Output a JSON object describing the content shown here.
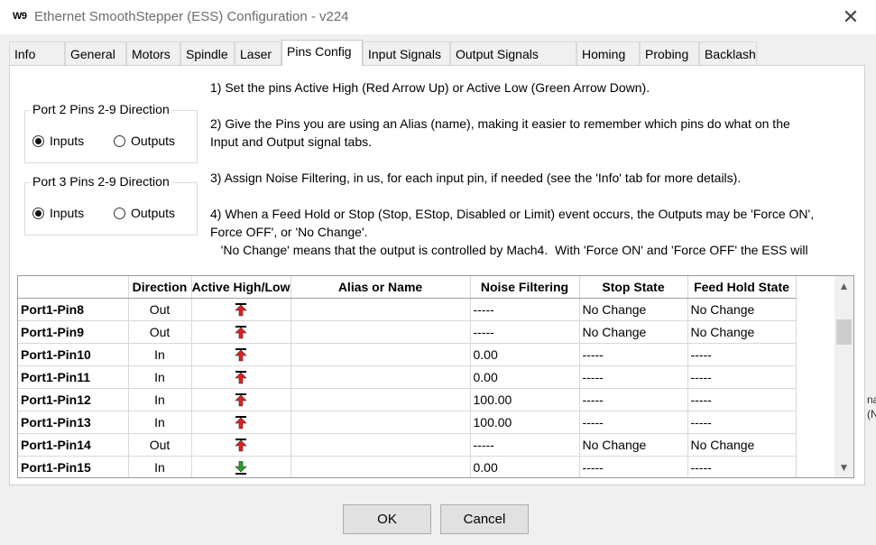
{
  "window": {
    "app_icon_text": "W9",
    "title": "Ethernet SmoothStepper (ESS) Configuration - v224",
    "close_icon": "close-icon"
  },
  "tabs": [
    {
      "label": "Info",
      "active": false
    },
    {
      "label": "General",
      "active": false
    },
    {
      "label": "Motors",
      "active": false
    },
    {
      "label": "Spindle",
      "active": false
    },
    {
      "label": "Laser",
      "active": false
    },
    {
      "label": "Pins Config",
      "active": true
    },
    {
      "label": "Input Signals",
      "active": false
    },
    {
      "label": "Output Signals",
      "active": false
    },
    {
      "label": "Homing",
      "active": false
    },
    {
      "label": "Probing",
      "active": false
    },
    {
      "label": "Backlash",
      "active": false
    }
  ],
  "port2": {
    "title": "Port 2 Pins 2-9 Direction",
    "option_inputs": "Inputs",
    "option_outputs": "Outputs",
    "selected": "Inputs"
  },
  "port3": {
    "title": "Port 3 Pins 2-9 Direction",
    "option_inputs": "Inputs",
    "option_outputs": "Outputs",
    "selected": "Inputs"
  },
  "instructions": {
    "line1": "1) Set the pins Active High (Red Arrow Up) or Active Low (Green Arrow Down).",
    "line2a": "2) Give the Pins you are using an Alias (name), making it easier to remember which pins do what on the",
    "line2b": "Input and Output signal tabs.",
    "line3": "3) Assign Noise Filtering, in us, for each input pin, if needed (see the 'Info' tab for more details).",
    "line4a": "4) When a Feed Hold or Stop (Stop, EStop, Disabled  or Limit) event occurs, the Outputs may be 'Force ON',",
    "line4b": "Force OFF', or 'No Change'.",
    "line4c": "   'No Change' means that the output is controlled by Mach4.  With 'Force ON' and 'Force OFF' the ESS will"
  },
  "table": {
    "columns": [
      "",
      "Direction",
      "Active High/Low",
      "Alias or Name",
      "Noise Filtering",
      "Stop State",
      "Feed Hold State"
    ],
    "rows": [
      {
        "pin": "Port1-Pin8",
        "direction": "Out",
        "active": "high",
        "alias": "",
        "noise": "-----",
        "stop": "No Change",
        "feed": "No Change"
      },
      {
        "pin": "Port1-Pin9",
        "direction": "Out",
        "active": "high",
        "alias": "",
        "noise": "-----",
        "stop": "No Change",
        "feed": "No Change"
      },
      {
        "pin": "Port1-Pin10",
        "direction": "In",
        "active": "high",
        "alias": "",
        "noise": "0.00",
        "stop": "-----",
        "feed": "-----"
      },
      {
        "pin": "Port1-Pin11",
        "direction": "In",
        "active": "high",
        "alias": "",
        "noise": "0.00",
        "stop": "-----",
        "feed": "-----"
      },
      {
        "pin": "Port1-Pin12",
        "direction": "In",
        "active": "high",
        "alias": "",
        "noise": "100.00",
        "stop": "-----",
        "feed": "-----"
      },
      {
        "pin": "Port1-Pin13",
        "direction": "In",
        "active": "high",
        "alias": "",
        "noise": "100.00",
        "stop": "-----",
        "feed": "-----"
      },
      {
        "pin": "Port1-Pin14",
        "direction": "Out",
        "active": "high",
        "alias": "",
        "noise": "-----",
        "stop": "No Change",
        "feed": "No Change"
      },
      {
        "pin": "Port1-Pin15",
        "direction": "In",
        "active": "low",
        "alias": "",
        "noise": "0.00",
        "stop": "-----",
        "feed": "-----"
      }
    ]
  },
  "colors": {
    "active_high_arrow": "#e02020",
    "active_low_arrow": "#22a022"
  },
  "buttons": {
    "ok": "OK",
    "cancel": "Cancel"
  },
  "background_peek": [
    "na",
    "(N"
  ]
}
